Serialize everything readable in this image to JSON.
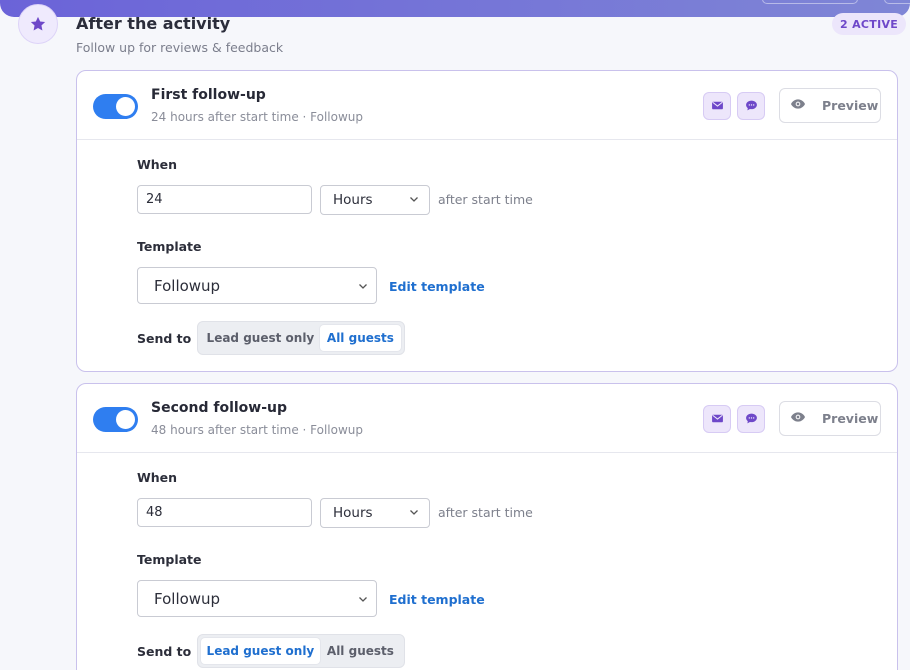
{
  "section": {
    "title": "After the activity",
    "subtitle": "Follow up for reviews & feedback",
    "badge": "2 ACTIVE",
    "icon": "star-icon"
  },
  "labels": {
    "when": "When",
    "template": "Template",
    "send_to": "Send to",
    "after_start": "after start time",
    "edit_template": "Edit template",
    "preview": "Preview",
    "lead_guest": "Lead guest only",
    "all_guests": "All guests"
  },
  "followups": [
    {
      "title": "First follow-up",
      "subtitle": "24 hours after start time · Followup",
      "enabled": true,
      "amount": "24",
      "unit": "Hours",
      "template": "Followup",
      "send_to": "All guests"
    },
    {
      "title": "Second follow-up",
      "subtitle": "48 hours after start time · Followup",
      "enabled": true,
      "amount": "48",
      "unit": "Hours",
      "template": "Followup",
      "send_to": "Lead guest only"
    }
  ],
  "colors": {
    "accent_purple": "#6e48c9",
    "toggle_blue": "#2f7ef0",
    "link_blue": "#1f6fcf"
  }
}
